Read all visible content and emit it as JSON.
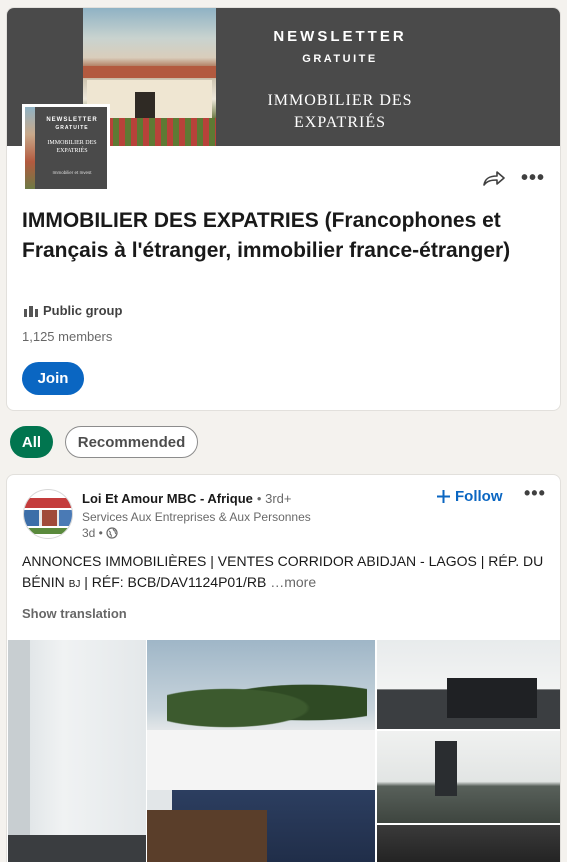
{
  "group": {
    "banner": {
      "title_line1": "NEWSLETTER",
      "title_line2": "GRATUITE",
      "subtitle": "IMMOBILIER DES EXPATRIÉS"
    },
    "logo": {
      "line1": "NEWSLETTER",
      "line2": "GRATUITE",
      "line3": "IMMOBILIER DES EXPATRIÉS",
      "line4": "Immobilier et Invest"
    },
    "name": "IMMOBILIER DES EXPATRIES (Francophones et Français à l'étranger, immobilier france-étranger)",
    "privacy": "Public group",
    "members": "1,125 members",
    "join_label": "Join"
  },
  "filters": {
    "all": "All",
    "recommended": "Recommended"
  },
  "post": {
    "author": "Loi Et Amour MBC - Afrique",
    "degree": "• 3rd+",
    "subtitle": "Services Aux Entreprises & Aux Personnes",
    "time": "3d •",
    "follow_label": "Follow",
    "text_main": "ANNONCES IMMOBILIÈRES | VENTES CORRIDOR ABIDJAN - LAGOS | RÉP. DU BÉNIN ",
    "text_small": "BJ",
    "text_rest": " | RÉF: BCB/DAV1124P01/RB",
    "more_label": "…more",
    "show_translation": "Show translation"
  },
  "icons": {
    "share": "share-arrow-icon",
    "more": "ellipsis-icon",
    "privacy": "group-icon",
    "globe": "globe-icon",
    "plus": "plus-icon"
  },
  "colors": {
    "primary": "#0a66c2",
    "filter_active": "#01754f",
    "banner": "#4a4a4a"
  }
}
